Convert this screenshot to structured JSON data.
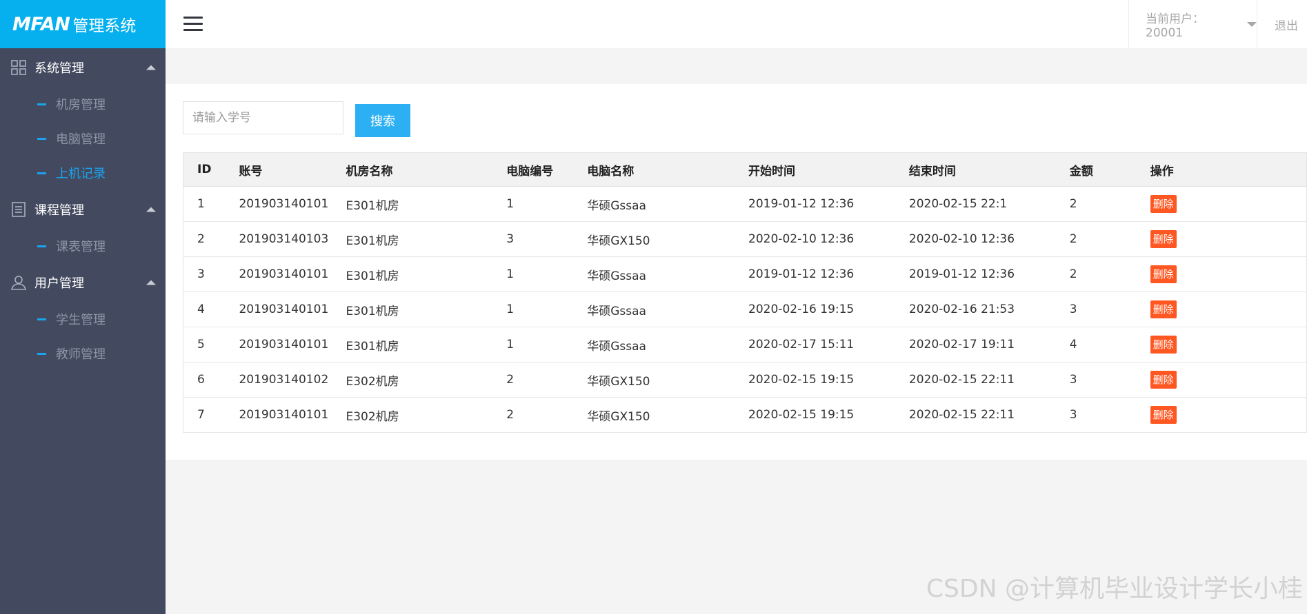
{
  "app": {
    "brand": "MFAN",
    "brand_sub": "管理系统"
  },
  "sidebar": {
    "groups": [
      {
        "label": "系统管理",
        "icon": "grid-icon",
        "items": [
          {
            "label": "机房管理",
            "active": false
          },
          {
            "label": "电脑管理",
            "active": false
          },
          {
            "label": "上机记录",
            "active": true
          }
        ]
      },
      {
        "label": "课程管理",
        "icon": "document-icon",
        "items": [
          {
            "label": "课表管理",
            "active": false
          }
        ]
      },
      {
        "label": "用户管理",
        "icon": "user-icon",
        "items": [
          {
            "label": "学生管理",
            "active": false
          },
          {
            "label": "教师管理",
            "active": false
          }
        ]
      }
    ]
  },
  "topbar": {
    "menu_icon": "hamburger-icon",
    "current_user": "当前用户：20001",
    "logout": "退出"
  },
  "search": {
    "placeholder": "请输入学号",
    "value": "",
    "button": "搜索"
  },
  "table": {
    "columns": [
      "ID",
      "账号",
      "机房名称",
      "电脑编号",
      "电脑名称",
      "开始时间",
      "结束时间",
      "金额",
      "操作"
    ],
    "rows": [
      [
        "1",
        "201903140101",
        "E301机房",
        "1",
        "华硕Gssaa",
        "2019-01-12 12:36",
        "2020-02-15 22:1",
        "2"
      ],
      [
        "2",
        "201903140103",
        "E301机房",
        "3",
        "华硕GX150",
        "2020-02-10 12:36",
        "2020-02-10 12:36",
        "2"
      ],
      [
        "3",
        "201903140101",
        "E301机房",
        "1",
        "华硕Gssaa",
        "2019-01-12 12:36",
        "2019-01-12 12:36",
        "2"
      ],
      [
        "4",
        "201903140101",
        "E301机房",
        "1",
        "华硕Gssaa",
        "2020-02-16 19:15",
        "2020-02-16 21:53",
        "3"
      ],
      [
        "5",
        "201903140101",
        "E301机房",
        "1",
        "华硕Gssaa",
        "2020-02-17 15:11",
        "2020-02-17 19:11",
        "4"
      ],
      [
        "6",
        "201903140102",
        "E302机房",
        "2",
        "华硕GX150",
        "2020-02-15 19:15",
        "2020-02-15 22:11",
        "3"
      ],
      [
        "7",
        "201903140101",
        "E302机房",
        "2",
        "华硕GX150",
        "2020-02-15 19:15",
        "2020-02-15 22:11",
        "3"
      ]
    ],
    "action_label": "删除"
  },
  "watermark": "CSDN @计算机毕业设计学长小桂",
  "colors": {
    "sidebar_bg": "#434a5f",
    "logo_bg": "#06b0ee",
    "accent": "#1aa3ee",
    "search_button": "#2db0f3",
    "danger": "#ff5722"
  }
}
